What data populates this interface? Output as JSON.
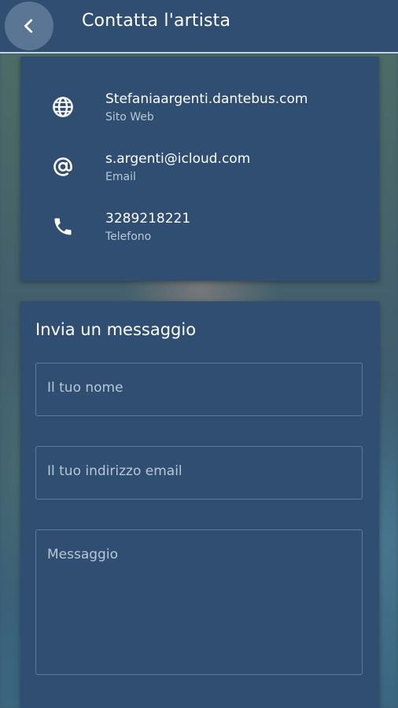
{
  "header": {
    "title": "Contatta l'artista",
    "back_icon": "chevron-left-icon"
  },
  "contacts": [
    {
      "icon": "globe-icon",
      "value": "Stefaniaargenti.dantebus.com",
      "label": "Sito Web"
    },
    {
      "icon": "at-icon",
      "value": "s.argenti@icloud.com",
      "label": "Email"
    },
    {
      "icon": "phone-icon",
      "value": "3289218221",
      "label": "Telefono"
    }
  ],
  "form": {
    "title": "Invia un messaggio",
    "name_placeholder": "Il tuo nome",
    "email_placeholder": "Il tuo indirizzo email",
    "message_placeholder": "Messaggio"
  },
  "colors": {
    "primary": "#2f4e72",
    "text": "#ffffff",
    "muted_text": "#b9c7d6"
  }
}
